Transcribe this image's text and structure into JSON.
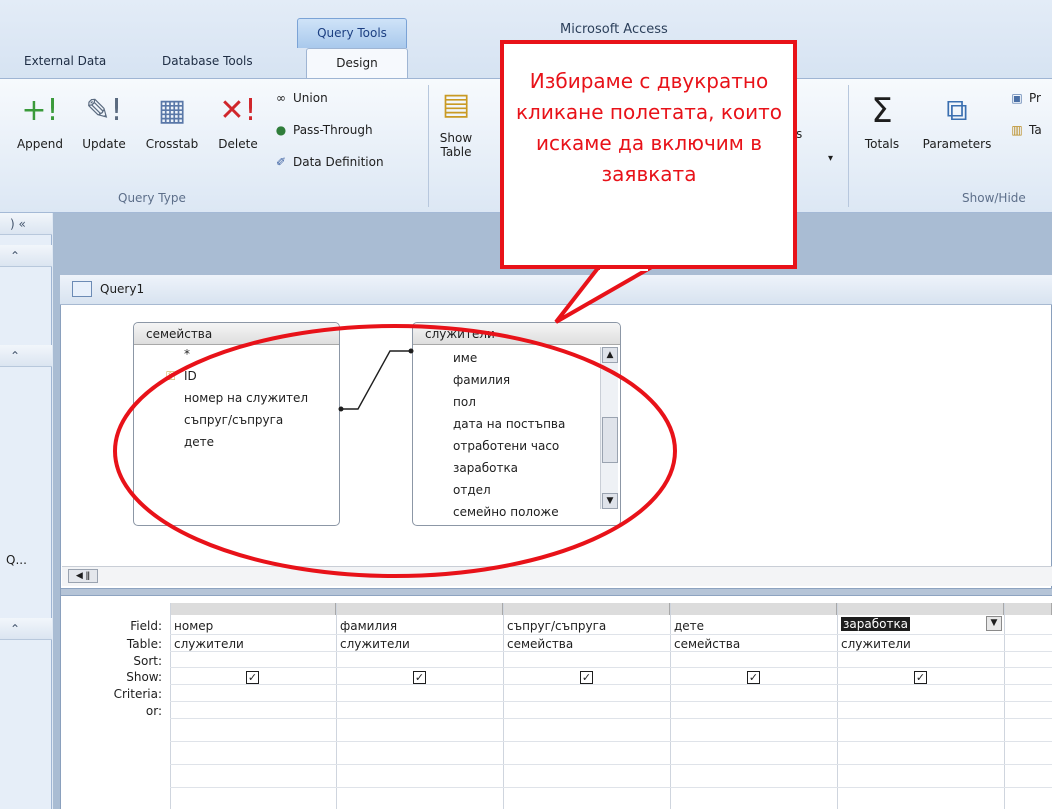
{
  "window": {
    "app_title": "Microsoft Access",
    "context_group": "Query Tools"
  },
  "tabs": [
    "External Data",
    "Database Tools",
    "Design"
  ],
  "ribbon": {
    "query_type": {
      "label": "Query Type",
      "buttons": [
        "Append",
        "Update",
        "Crosstab",
        "Delete"
      ],
      "small": [
        "Union",
        "Pass-Through",
        "Data Definition"
      ]
    },
    "show_table_line1": "Show",
    "show_table_line2": "Table",
    "partial_text": "s",
    "show_hide": {
      "label": "Show/Hide",
      "buttons": [
        "Totals",
        "Parameters"
      ],
      "partial_items": [
        "Pr",
        "Ta"
      ]
    }
  },
  "nav": {
    "truncated_item": "Q..."
  },
  "query": {
    "title": "Query1",
    "tables": [
      {
        "name": "семейства",
        "fields": [
          "*",
          "ID",
          "номер на служител",
          "съпруг/съпруга",
          "дете"
        ]
      },
      {
        "name": "служители",
        "fields": [
          "име",
          "фамилия",
          "пол",
          "дата на постъпва",
          "отработени часо",
          "заработка",
          "отдел",
          "семейно положе"
        ]
      }
    ]
  },
  "grid": {
    "row_labels": [
      "Field:",
      "Table:",
      "Sort:",
      "Show:",
      "Criteria:",
      "or:"
    ],
    "columns": [
      {
        "field": "номер",
        "table": "служители",
        "show": true
      },
      {
        "field": "фамилия",
        "table": "служители",
        "show": true
      },
      {
        "field": "съпруг/съпруга",
        "table": "семейства",
        "show": true
      },
      {
        "field": "дете",
        "table": "семейства",
        "show": true
      },
      {
        "field": "заработка",
        "table": "служители",
        "show": true
      }
    ]
  },
  "callout": {
    "text": "Избираме с двукратно кликане полетата, които искаме да включим в заявката",
    "color": "#e81219"
  }
}
